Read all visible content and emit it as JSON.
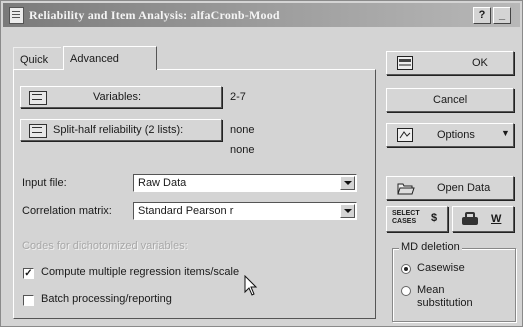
{
  "window": {
    "title": "Reliability and Item Analysis: alfaCronb-Mood",
    "help_btn": "?",
    "min_btn": "_"
  },
  "tabs": [
    {
      "label": "Quick",
      "selected": false
    },
    {
      "label": "Advanced",
      "selected": true
    }
  ],
  "panel": {
    "variables_button": "Variables:",
    "variables_value": "2-7",
    "split_half_button": "Split-half reliability (2 lists):",
    "split_half_value1": "none",
    "split_half_value2": "none",
    "input_file_label": "Input file:",
    "input_file_value": "Raw Data",
    "corr_matrix_label": "Correlation matrix:",
    "corr_matrix_value": "Standard Pearson r",
    "codes_label": "Codes for dichotomized variables:",
    "compute_checkbox_label": "Compute multiple regression items/scale",
    "compute_checked": true,
    "compute_mark": "✓",
    "batch_checkbox_label": "Batch processing/reporting",
    "batch_checked": false
  },
  "right": {
    "ok": "OK",
    "cancel": "Cancel",
    "options": "Options",
    "open_data": "Open Data",
    "select_cases_line1": "SELECT",
    "select_cases_line2": "CASES",
    "sort_glyph": "$",
    "weight_glyph": "W",
    "md_group_title": "MD deletion",
    "md_options": [
      {
        "label": "Casewise",
        "selected": true
      },
      {
        "label": "Mean substitution",
        "selected": false
      }
    ]
  }
}
